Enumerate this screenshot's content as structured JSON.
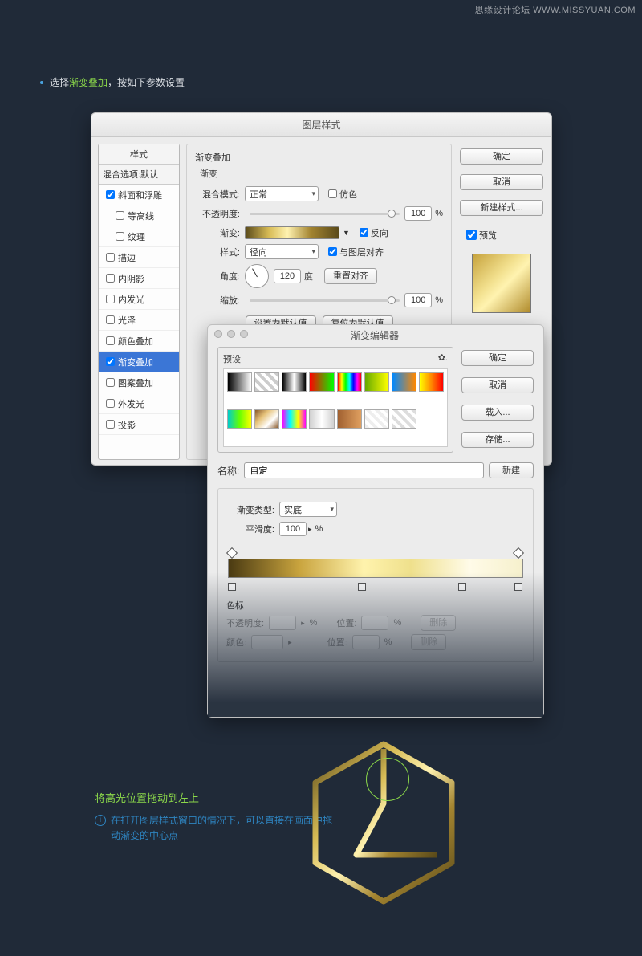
{
  "watermark": "思缘设计论坛 WWW.MISSYUAN.COM",
  "caption": {
    "pre": "选择",
    "highlight": "渐变叠加",
    "post": "，按如下参数设置"
  },
  "layerStyle": {
    "title": "图层样式",
    "stylesHeader": "样式",
    "blendingOptions": "混合选项:默认",
    "items": [
      {
        "label": "斜面和浮雕",
        "checked": true,
        "indent": 0,
        "sel": false
      },
      {
        "label": "等高线",
        "checked": false,
        "indent": 1,
        "sel": false
      },
      {
        "label": "纹理",
        "checked": false,
        "indent": 1,
        "sel": false
      },
      {
        "label": "描边",
        "checked": false,
        "indent": 0,
        "sel": false
      },
      {
        "label": "内阴影",
        "checked": false,
        "indent": 0,
        "sel": false
      },
      {
        "label": "内发光",
        "checked": false,
        "indent": 0,
        "sel": false
      },
      {
        "label": "光泽",
        "checked": false,
        "indent": 0,
        "sel": false
      },
      {
        "label": "颜色叠加",
        "checked": false,
        "indent": 0,
        "sel": false
      },
      {
        "label": "渐变叠加",
        "checked": true,
        "indent": 0,
        "sel": true
      },
      {
        "label": "图案叠加",
        "checked": false,
        "indent": 0,
        "sel": false
      },
      {
        "label": "外发光",
        "checked": false,
        "indent": 0,
        "sel": false
      },
      {
        "label": "投影",
        "checked": false,
        "indent": 0,
        "sel": false
      }
    ],
    "sectionTitle": "渐变叠加",
    "subsectionTitle": "渐变",
    "blendModeLabel": "混合模式:",
    "blendModeValue": "正常",
    "ditherLabel": "仿色",
    "ditherChecked": false,
    "opacityLabel": "不透明度:",
    "opacityValue": "100",
    "gradientLabel": "渐变:",
    "reverseLabel": "反向",
    "reverseChecked": true,
    "styleLabel": "样式:",
    "styleValue": "径向",
    "alignLabel": "与图层对齐",
    "alignChecked": true,
    "angleLabel": "角度:",
    "angleValue": "120",
    "angleUnit": "度",
    "resetAlign": "重置对齐",
    "scaleLabel": "缩放:",
    "scaleValue": "100",
    "setDefault": "设置为默认值",
    "resetDefault": "复位为默认值",
    "ok": "确定",
    "cancel": "取消",
    "newStyle": "新建样式...",
    "previewLabel": "预览",
    "previewChecked": true
  },
  "gradEditor": {
    "title": "渐变编辑器",
    "presetsLabel": "预设",
    "gearIcon": "✿.",
    "swatches": [
      "linear-gradient(90deg,#000,#fff)",
      "repeating-linear-gradient(45deg,#ccc 0 4px,#fff 4px 8px)",
      "linear-gradient(90deg,#000,#fff 50%,#000)",
      "linear-gradient(90deg,#f00,#0f0)",
      "linear-gradient(90deg,#f00,#ff0,#0f0,#0ff,#00f,#f0f,#f00)",
      "linear-gradient(90deg,#6a0,#ff0)",
      "linear-gradient(90deg,#08f,#f80)",
      "linear-gradient(90deg,#ff0,#f80,#f00)",
      "linear-gradient(90deg,#0cc,#6f0,#ff0)",
      "linear-gradient(135deg,#8a5a2b,#e6c27a,#fff,#8a5a2b)",
      "linear-gradient(90deg,#f0f,#0ff,#ff0,#f0f)",
      "linear-gradient(90deg,#d0d0d0,#fff,#d0d0d0)",
      "linear-gradient(90deg,#a06030,#e0a060)",
      "repeating-linear-gradient(45deg,#eee 0 4px,#fff 4px 8px)",
      "repeating-linear-gradient(45deg,#ddd 0 4px,transparent 4px 8px)"
    ],
    "ok": "确定",
    "cancel": "取消",
    "load": "载入...",
    "save": "存储...",
    "nameLabel": "名称:",
    "nameValue": "自定",
    "newBtn": "新建",
    "typeLabel": "渐变类型:",
    "typeValue": "实底",
    "smoothLabel": "平滑度:",
    "smoothValue": "100",
    "stopsHeader": "色标",
    "stopOpacityLabel": "不透明度:",
    "stopPosLabel": "位置:",
    "deleteLabel": "删除",
    "stopColorLabel": "颜色:"
  },
  "bottom": {
    "greenText": "将高光位置拖动到左上",
    "infoText": "在打开图层样式窗口的情况下，可以直接在画面中拖动渐变的中心点"
  }
}
